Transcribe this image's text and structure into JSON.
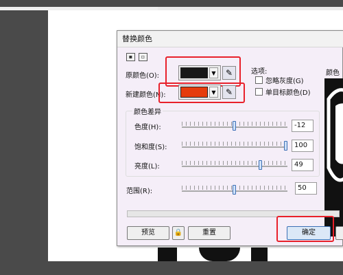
{
  "dialog": {
    "title": "替换颜色",
    "original_color_label": "原颜色(O):",
    "new_color_label": "新建颜色(N):",
    "original_color": "#181818",
    "new_color": "#e53c0c",
    "dropdown_glyph": "▼",
    "options_label": "选项:",
    "ignore_gray_label": "忽略灰度(G)",
    "single_target_label": "单目标颜色(D)",
    "preview_label": "颜色",
    "diff_group_label": "颜色差异",
    "hue_label": "色度(H):",
    "saturation_label": "饱和度(S):",
    "brightness_label": "亮度(L):",
    "range_label": "范围(R):",
    "hue_value": "-12",
    "saturation_value": "100",
    "brightness_value": "49",
    "range_value": "50",
    "preview_button": "预览",
    "reset_button": "重置",
    "ok_button": "确定",
    "hue_level": 0.5,
    "saturation_level": 1.0,
    "brightness_level": 0.75,
    "range_level": 0.5
  },
  "icons": {
    "eyedropper": "eyedropper-icon",
    "lock": "lock-icon"
  },
  "colors": {
    "highlight": "#e8202a",
    "slider_thumb": "#3b6fb5"
  }
}
